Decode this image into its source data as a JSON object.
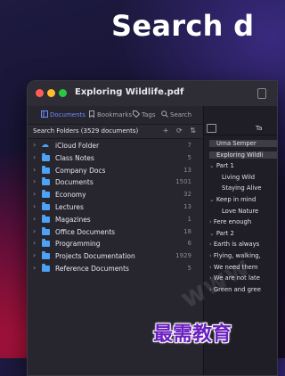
{
  "headline": "Search d",
  "window": {
    "title": "Exploring Wildlife.pdf"
  },
  "tabs": [
    {
      "label": "Documents",
      "icon": "documents-icon",
      "active": true
    },
    {
      "label": "Bookmarks",
      "icon": "bookmark-icon",
      "active": false
    },
    {
      "label": "Tags",
      "icon": "tag-icon",
      "active": false
    },
    {
      "label": "Search",
      "icon": "search-icon",
      "active": false
    }
  ],
  "search_folders": {
    "label": "Search Folders (3529 documents)",
    "icons": "+ ⟳ ⇅"
  },
  "folders": [
    {
      "name": "iCloud Folder",
      "count": "7",
      "icon": "cloud-icon"
    },
    {
      "name": "Class Notes",
      "count": "5",
      "icon": "folder-icon"
    },
    {
      "name": "Company Docs",
      "count": "13",
      "icon": "folder-icon"
    },
    {
      "name": "Documents",
      "count": "1501",
      "icon": "folder-icon"
    },
    {
      "name": "Economy",
      "count": "32",
      "icon": "folder-icon"
    },
    {
      "name": "Lectures",
      "count": "13",
      "icon": "folder-icon"
    },
    {
      "name": "Magazines",
      "count": "1",
      "icon": "folder-icon"
    },
    {
      "name": "Office Documents",
      "count": "18",
      "icon": "folder-icon"
    },
    {
      "name": "Programming",
      "count": "6",
      "icon": "folder-icon"
    },
    {
      "name": "Projects Documentation",
      "count": "1929",
      "icon": "folder-icon"
    },
    {
      "name": "Reference Documents",
      "count": "5",
      "icon": "folder-icon"
    }
  ],
  "toc": {
    "header": "Ta",
    "items": [
      {
        "text": "Urna Semper",
        "chev": ""
      },
      {
        "text": "Exploring Wildli",
        "chev": ""
      },
      {
        "text": "Part 1",
        "chev": "⌄"
      },
      {
        "text": "Living Wild",
        "chev": ""
      },
      {
        "text": "Staying Alive",
        "chev": ""
      },
      {
        "text": "Keep in mind",
        "chev": "⌄"
      },
      {
        "text": "Love Nature",
        "chev": ""
      },
      {
        "text": "Fere enough",
        "chev": "›"
      },
      {
        "text": "Part 2",
        "chev": "⌄"
      },
      {
        "text": "Earth is always",
        "chev": "›"
      },
      {
        "text": "Flying, walking,",
        "chev": "›"
      },
      {
        "text": "We need them",
        "chev": "›"
      },
      {
        "text": "We are not late",
        "chev": "›"
      },
      {
        "text": "Green and gree",
        "chev": "›"
      }
    ]
  },
  "watermark": "www",
  "brand": "最需教育"
}
